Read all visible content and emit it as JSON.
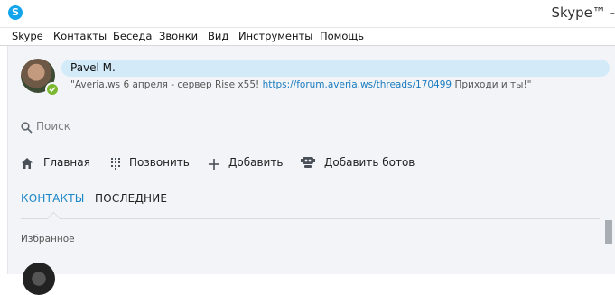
{
  "app": {
    "window_title": "Skype™ -",
    "logo_letter": "S"
  },
  "menu": {
    "items": [
      "Skype",
      "Контакты",
      "Беседа",
      "Звонки",
      "Вид",
      "Инструменты",
      "Помощь"
    ]
  },
  "profile": {
    "name": "Pavel M.",
    "status": "online",
    "mood_prefix": "\"Averia.ws 6 апреля - сервер Rise x55!",
    "mood_link": "https://forum.averia.ws/threads/170499",
    "mood_suffix": "Приходи и ты!\""
  },
  "search": {
    "placeholder": "Поиск"
  },
  "nav": {
    "home": "Главная",
    "call": "Позвонить",
    "add": "Добавить",
    "add_bots": "Добавить ботов"
  },
  "tabs": {
    "contacts": "КОНТАКТЫ",
    "recent": "ПОСЛЕДНИЕ"
  },
  "sections": {
    "favorites": "Избранное"
  },
  "colors": {
    "accent": "#1a86c7",
    "brand": "#12a5ec",
    "namebar_bg": "#d3ebf9",
    "online": "#7cb82f"
  }
}
